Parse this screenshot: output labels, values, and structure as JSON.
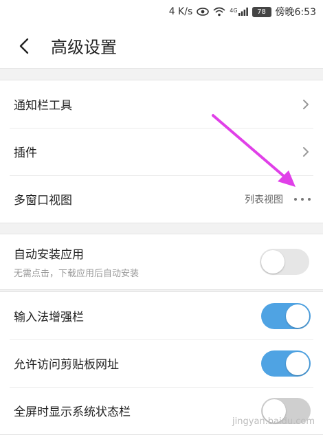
{
  "status_bar": {
    "network_speed": "4 K/s",
    "network_type": "4G",
    "battery": "78",
    "time": "傍晚6:53"
  },
  "header": {
    "title": "高级设置"
  },
  "groups": [
    {
      "rows": [
        {
          "label": "通知栏工具"
        },
        {
          "label": "插件"
        },
        {
          "label": "多窗口视图",
          "value": "列表视图"
        }
      ]
    },
    {
      "rows": [
        {
          "label": "自动安装应用",
          "sublabel": "无需点击，下载应用后自动安装",
          "toggle": "off"
        }
      ]
    },
    {
      "rows": [
        {
          "label": "输入法增强栏",
          "toggle": "on"
        },
        {
          "label": "允许访问剪贴板网址",
          "toggle": "on"
        },
        {
          "label": "全屏时显示系统状态栏",
          "toggle": "off"
        }
      ]
    }
  ],
  "annotation": {
    "arrow_color": "#e040e8"
  },
  "colors": {
    "toggle_on": "#4fa3e3",
    "toggle_off": "#e6e6e6",
    "background": "#f2f2f2"
  },
  "watermark": "jingyan.baidu.com"
}
